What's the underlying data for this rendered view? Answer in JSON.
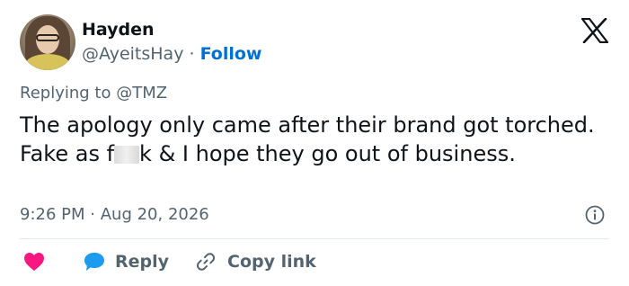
{
  "author": {
    "name": "Hayden",
    "handle": "@AyeitsHay",
    "separator": "·",
    "follow_label": "Follow"
  },
  "brand_icon": "x-logo-icon",
  "reply_context": {
    "prefix": "Replying to",
    "mention": "@TMZ"
  },
  "tweet": {
    "text_before": "The apology only came after their brand got torched. Fake as f",
    "text_after": "k & I hope they go out of business."
  },
  "meta": {
    "time": "9:26 PM",
    "separator": "·",
    "date": "Aug 20, 2026"
  },
  "actions": {
    "like_icon": "heart-icon",
    "reply_icon": "speech-bubble-icon",
    "reply_label": "Reply",
    "copy_icon": "link-icon",
    "copy_label": "Copy link"
  },
  "colors": {
    "text": "#0f1419",
    "secondary": "#536471",
    "follow": "#006fd6",
    "heart": "#f91880",
    "reply_bubble": "#1d9bf0",
    "divider": "#e1e8ed"
  }
}
